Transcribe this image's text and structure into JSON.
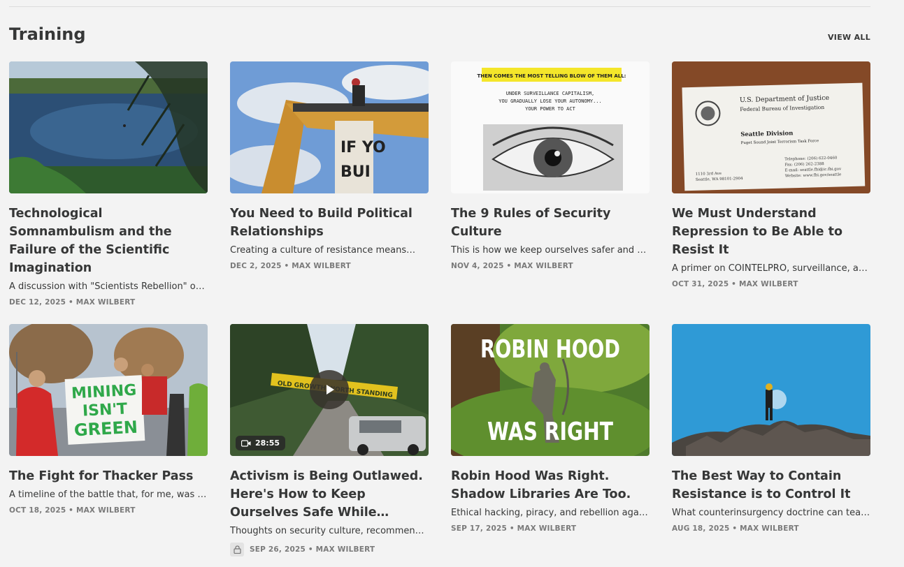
{
  "section": {
    "title": "Training",
    "view_all": "VIEW ALL"
  },
  "cards": [
    {
      "title": "Technological Somnambulism and the Failure of the Scientific Imagination",
      "subtitle": "A discussion with \"Scientists Rebellion\" on…",
      "meta": "DEC 12, 2025 • MAX WILBERT"
    },
    {
      "title": "You Need to Build Political Relationships",
      "subtitle": "Creating a culture of resistance means…",
      "meta": "DEC 2, 2025 • MAX WILBERT",
      "image_text": "IF YOU BUIL"
    },
    {
      "title": "The 9 Rules of Security Culture",
      "subtitle": "This is how we keep ourselves safer and mo…",
      "meta": "NOV 4, 2025 • MAX WILBERT",
      "image_banner": "THEN COMES THE MOST TELLING BLOW OF THEM ALL:",
      "image_lines": [
        "UNDER SURVEILLANCE CAPITALISM,",
        "YOU GRADUALLY LOSE YOUR AUTONOMY...",
        "YOUR POWER TO ACT"
      ]
    },
    {
      "title": "We Must Understand Repression to Be Able to Resist It",
      "subtitle": "A primer on COINTELPRO, surveillance, and…",
      "meta": "OCT 31, 2025 • MAX WILBERT",
      "image_card": {
        "dept": "U.S. Department of Justice",
        "bureau": "Federal Bureau of Investigation",
        "division": "Seattle Division",
        "task_force": "Puget Sound Joint Terrorism Task Force",
        "address1": "1110 3rd Ave",
        "address2": "Seattle, WA 98101-2904",
        "telephone": "Telephone:   (206) 622-0460",
        "fax": "Fax:   (206) 262-2388",
        "email": "E-mail:   seattle.fbi@ic.fbi.gov",
        "website": "Website:  www.fbi.gov/seattle"
      }
    },
    {
      "title": "The Fight for Thacker Pass",
      "subtitle": "A timeline of the battle that, for me, was not…",
      "meta": "OCT 18, 2025 • MAX WILBERT",
      "image_sign": [
        "MINING",
        "ISN'T",
        "GREEN"
      ]
    },
    {
      "title": "Activism is Being Outlawed. Here's How to Keep Ourselves Safe While Continuing the…",
      "subtitle": "Thoughts on security culture, recommended…",
      "meta": "SEP 26, 2025 • MAX WILBERT",
      "duration": "28:55",
      "image_banner": "OLD GROWTH WORTH STANDING"
    },
    {
      "title": "Robin Hood Was Right. Shadow Libraries Are Too.",
      "subtitle": "Ethical hacking, piracy, and rebellion against…",
      "meta": "SEP 17, 2025 • MAX WILBERT",
      "image_top": "ROBIN HOOD",
      "image_bottom": "WAS RIGHT"
    },
    {
      "title": "The Best Way to Contain Resistance is to Control It",
      "subtitle": "What counterinsurgency doctrine can teach…",
      "meta": "AUG 18, 2025 • MAX WILBERT"
    }
  ]
}
